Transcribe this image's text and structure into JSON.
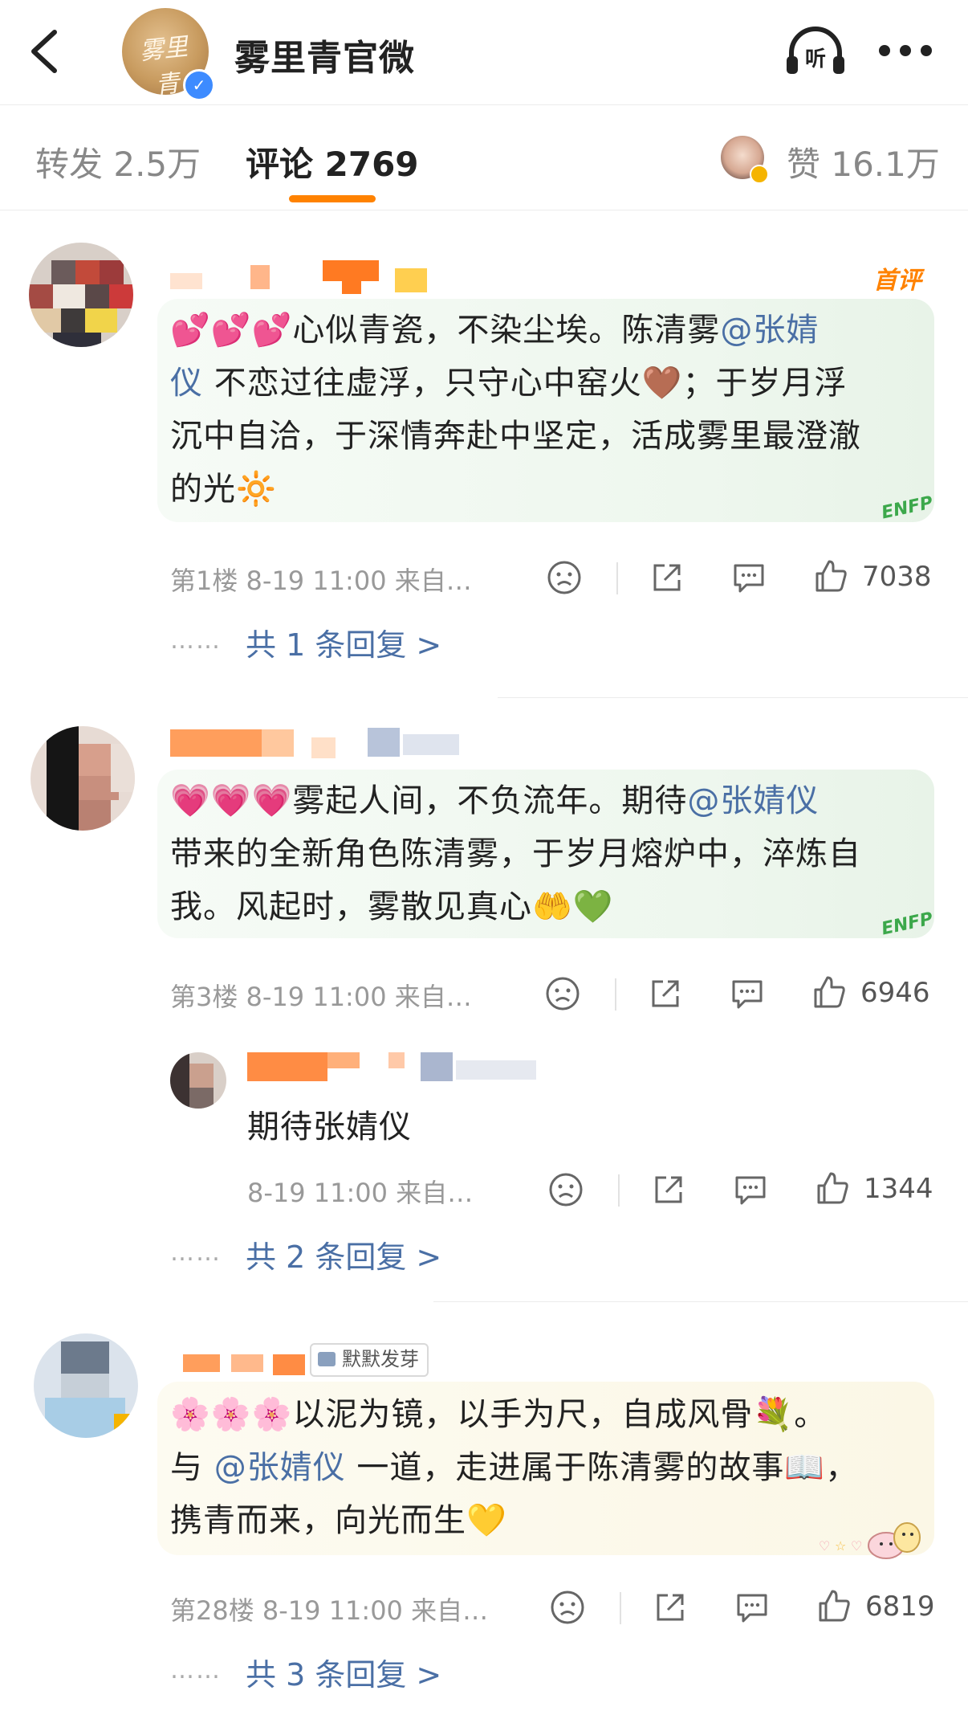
{
  "header": {
    "account_name": "雾里青官微",
    "avatar_logo_text": "雾里青"
  },
  "tabs": {
    "repost": "转发 2.5万",
    "comments": "评论 2769",
    "likes": "赞 16.1万"
  },
  "colors": {
    "accent": "#ff8200",
    "mention": "#4a6fa5",
    "verified": "#3d8bff"
  },
  "comments": [
    {
      "badge": "首评",
      "lines": [
        {
          "emoji": "💕💕💕",
          "text": "心似青瓷，不染尘埃。陈清雾",
          "mention": "@张婧"
        },
        {
          "mention": "仪",
          "text": " 不恋过往虚浮，只守心中窑火🤎；于岁月浮"
        },
        {
          "text": "沉中自洽，于深情奔赴中坚定，活成雾里最澄澈"
        },
        {
          "text": "的光🔆"
        }
      ],
      "bubble_deco": "ENFP",
      "meta": "第1楼  8-19 11:00  来自…",
      "likes": "7038",
      "replies": "共 1 条回复 >"
    },
    {
      "lines": [
        {
          "emoji": "💗💗💗",
          "text": "雾起人间，不负流年。期待",
          "mention": "@张婧仪"
        },
        {
          "text": "带来的全新角色陈清雾，于岁月熔炉中，淬炼自"
        },
        {
          "text": "我。风起时，雾散见真心🤲💚"
        }
      ],
      "bubble_deco": "ENFP",
      "meta": "第3楼  8-19 11:00  来自…",
      "likes": "6946",
      "sub_reply": {
        "text": "期待张婧仪",
        "meta": "8-19 11:00  来自…",
        "likes": "1344"
      },
      "replies": "共 2 条回复 >"
    },
    {
      "tag": "默默发芽",
      "lines": [
        {
          "emoji": "🌸🌸🌸",
          "text": "以泥为镜，以手为尺，自成风骨💐。"
        },
        {
          "text": "与 ",
          "mention": "@张婧仪",
          "text2": " 一道，走进属于陈清雾的故事📖，"
        },
        {
          "text": "携青而来，向光而生💛"
        }
      ],
      "meta": "第28楼  8-19 11:00  来自…",
      "likes": "6819",
      "replies": "共 3 条回复 >"
    }
  ]
}
